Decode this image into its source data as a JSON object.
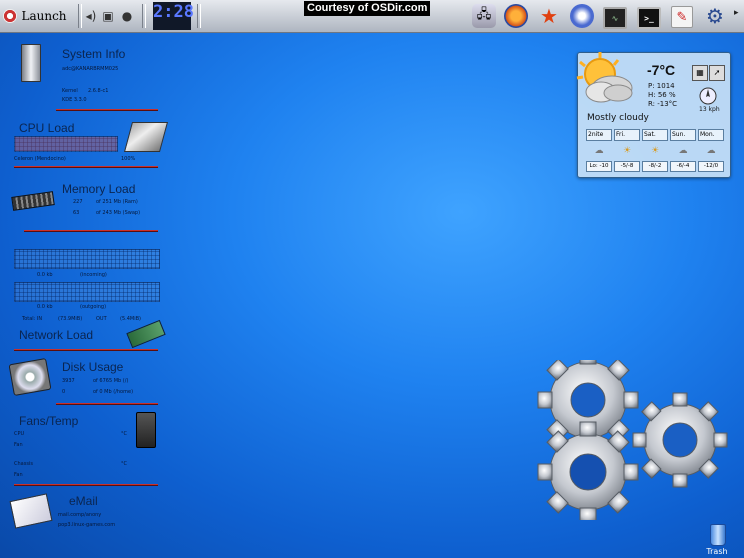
{
  "panel": {
    "launch_label": "Launch",
    "clock_time": "2:28",
    "clock_date": "",
    "courtesy": "Courtesy of OSDir.com"
  },
  "sysinfo": {
    "title": "System Info",
    "host": "adc@KANARBRMM025",
    "kernel_label": "Kernel",
    "kernel_value": "2.6.8-c1",
    "kde_label": "KDE 3.3.0"
  },
  "cpu": {
    "title": "CPU Load",
    "name": "Celeron (Mendocino)",
    "percent": "100%",
    "load_fraction": 1.0
  },
  "memory": {
    "title": "Memory Load",
    "ram_used": "227",
    "ram_total": "of 251 Mb (Ram)",
    "swap_used": "63",
    "swap_total": "of 243 Mb (Swap)"
  },
  "netgraph": {
    "incoming_value": "0.0 kb",
    "incoming_label": "(incoming)",
    "outgoing_value": "0.0 kb",
    "outgoing_label": "(outgoing)",
    "total_in_label": "Total: IN",
    "total_in_value": "(73.9MiB)",
    "out_label": "OUT",
    "out_value": "(5.4MiB)"
  },
  "network": {
    "title": "Network Load"
  },
  "disk": {
    "title": "Disk Usage",
    "root_used": "3937",
    "root_total": "of 6765 Mb (/)",
    "home_used": "0",
    "home_total": "of 0 Mb (/home)"
  },
  "fans": {
    "title": "Fans/Temp",
    "cpu_label": "CPU",
    "cpu_unit": "°C",
    "fan1_label": "Fan",
    "chassis_label": "Chassis",
    "chassis_unit": "°C",
    "fan2_label": "Fan"
  },
  "email": {
    "title": "eMail",
    "account1": "mail.comp/anony",
    "account2": "pop3.linux-games.com"
  },
  "weather": {
    "temp": "-7°C",
    "pressure": "P:  1014",
    "humidity": "H:  56 %",
    "realfeel": "R:  -13°C",
    "condition": "Mostly cloudy",
    "wind": "13 kph",
    "forecast": [
      {
        "day": "2nite",
        "temps": "Lo: -10"
      },
      {
        "day": "Fri.",
        "temps": "-5/-8"
      },
      {
        "day": "Sat.",
        "temps": "-8/-2"
      },
      {
        "day": "Sun.",
        "temps": "-6/-4"
      },
      {
        "day": "Mon.",
        "temps": "-12/0"
      }
    ]
  },
  "desktop": {
    "trash_label": "Trash"
  },
  "colors": {
    "section_line": "#c9302c",
    "panel": "#d3d8df",
    "desktop": "#1f82f0"
  },
  "icons": [
    "kmenu-gear-icon",
    "speaker-icon",
    "desktops-icon",
    "bomb-icon",
    "network-computer-icon",
    "firefox-icon",
    "star-icon",
    "wireless-icon",
    "monitor-graph-icon",
    "terminal-icon",
    "notes-icon",
    "settings-gear-icon"
  ]
}
